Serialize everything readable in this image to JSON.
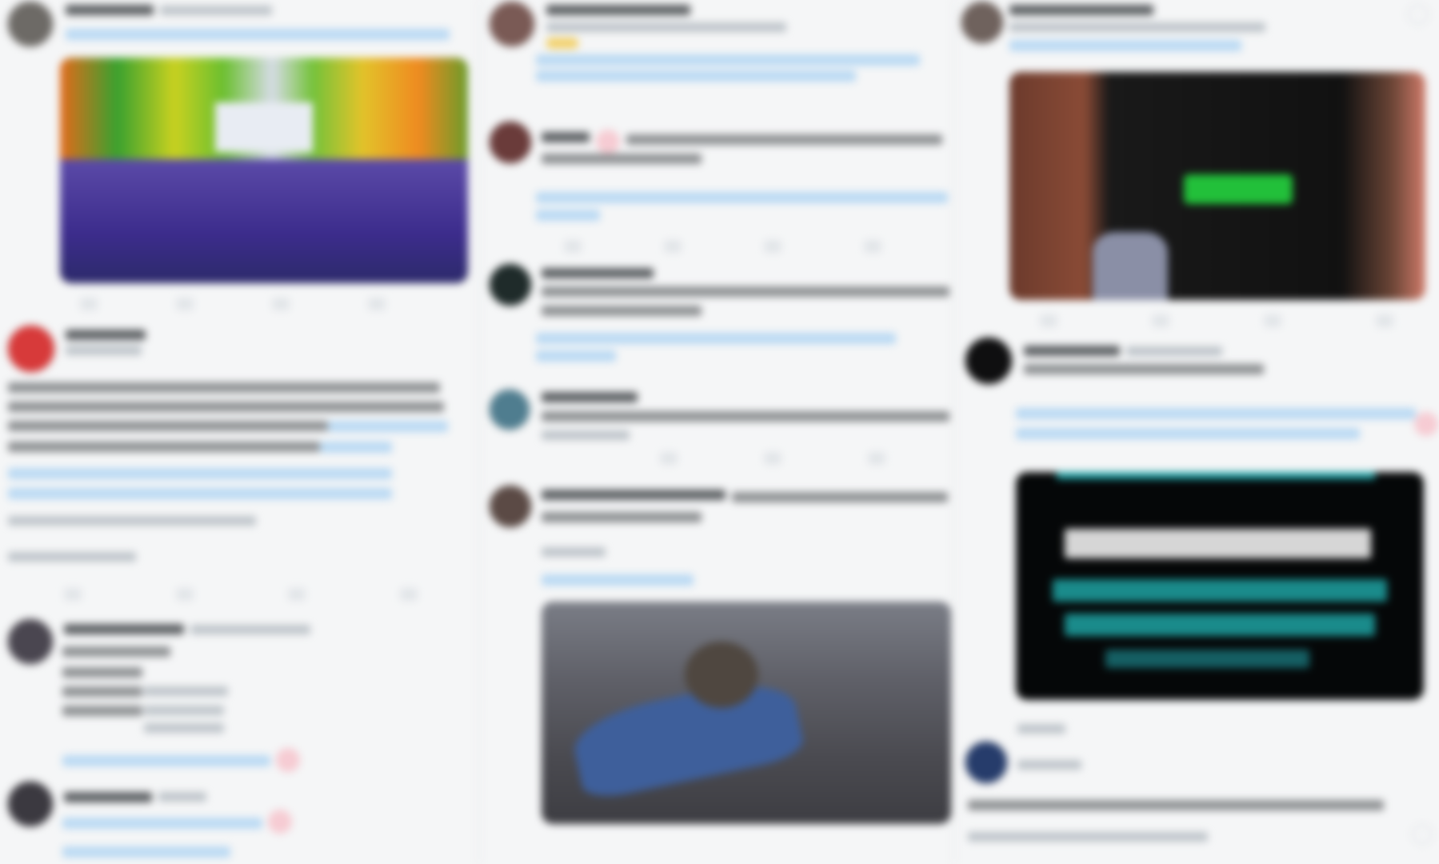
{
  "feed": {
    "columns": [
      {
        "tweets": [
          {
            "kind": "media",
            "avatar_color": "#6d6a66",
            "media": "stadium-photo"
          },
          {
            "kind": "text",
            "avatar_color": "#d73a3a"
          },
          {
            "kind": "thread",
            "avatar_color": "#4a4650"
          },
          {
            "kind": "text",
            "avatar_color": "#3b3940"
          }
        ]
      },
      {
        "tweets": [
          {
            "kind": "link",
            "avatar_color": "#7a5a55"
          },
          {
            "kind": "link",
            "avatar_color": "#6a3b3a"
          },
          {
            "kind": "link",
            "avatar_color": "#1f2b2a"
          },
          {
            "kind": "text",
            "avatar_color": "#4f7d8f"
          },
          {
            "kind": "media",
            "avatar_color": "#5b4a45",
            "media": "sofa-video-still"
          }
        ]
      },
      {
        "tweets": [
          {
            "kind": "media",
            "avatar_color": "#6f625d",
            "media": "shirt-photo"
          },
          {
            "kind": "link-media",
            "avatar_color": "#0f0f10",
            "media": "terminal-screenshot"
          },
          {
            "kind": "text",
            "avatar_color": "#263c6b"
          }
        ]
      }
    ]
  }
}
